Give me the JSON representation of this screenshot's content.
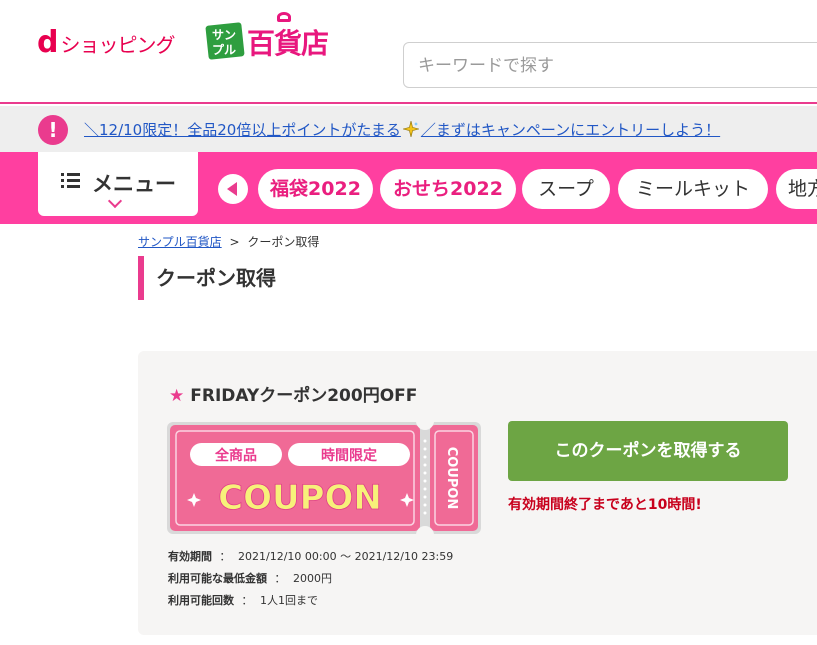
{
  "header": {
    "logo_d_letter": "d",
    "logo_d_text": "ショッピング",
    "store_logo_small_1": "サン",
    "store_logo_small_2": "プル",
    "store_logo_big": "百貨店",
    "search_placeholder": "キーワードで探す"
  },
  "notice": {
    "icon_text": "!",
    "text_before": "＼12/10限定！全品20倍以上ポイントがたまる",
    "text_after": "／まずはキャンペーンにエントリーしよう！"
  },
  "nav": {
    "menu_label": "メニュー",
    "categories": [
      "福袋2022",
      "おせち2022",
      "スープ",
      "ミールキット",
      "地方"
    ]
  },
  "breadcrumb": {
    "home": "サンプル百貨店",
    "separator": ">",
    "current": "クーポン取得"
  },
  "page_title": "クーポン取得",
  "coupon": {
    "star": "★",
    "title": "FRIDAYクーポン200円OFF",
    "ticket": {
      "tag_left": "全商品",
      "tag_right": "時間限定",
      "main": "COUPON",
      "side": "COUPON"
    },
    "button_label": "このクーポンを取得する",
    "remaining": "有効期間終了まであと10時間!",
    "meta": [
      {
        "label": "有効期間",
        "value": "2021/12/10 00:00 〜 2021/12/10 23:59"
      },
      {
        "label": "利用可能な最低金額",
        "value": "2000円"
      },
      {
        "label": "利用可能回数",
        "value": "1人1回まで"
      }
    ],
    "meta_separator": "："
  },
  "colors": {
    "brand_pink": "#ff3fa0",
    "accent_pink": "#ea3b8e",
    "coupon_pink": "#f06a96",
    "button_green": "#6da544",
    "alert_red": "#c8001c",
    "link_blue": "#2157c5"
  }
}
